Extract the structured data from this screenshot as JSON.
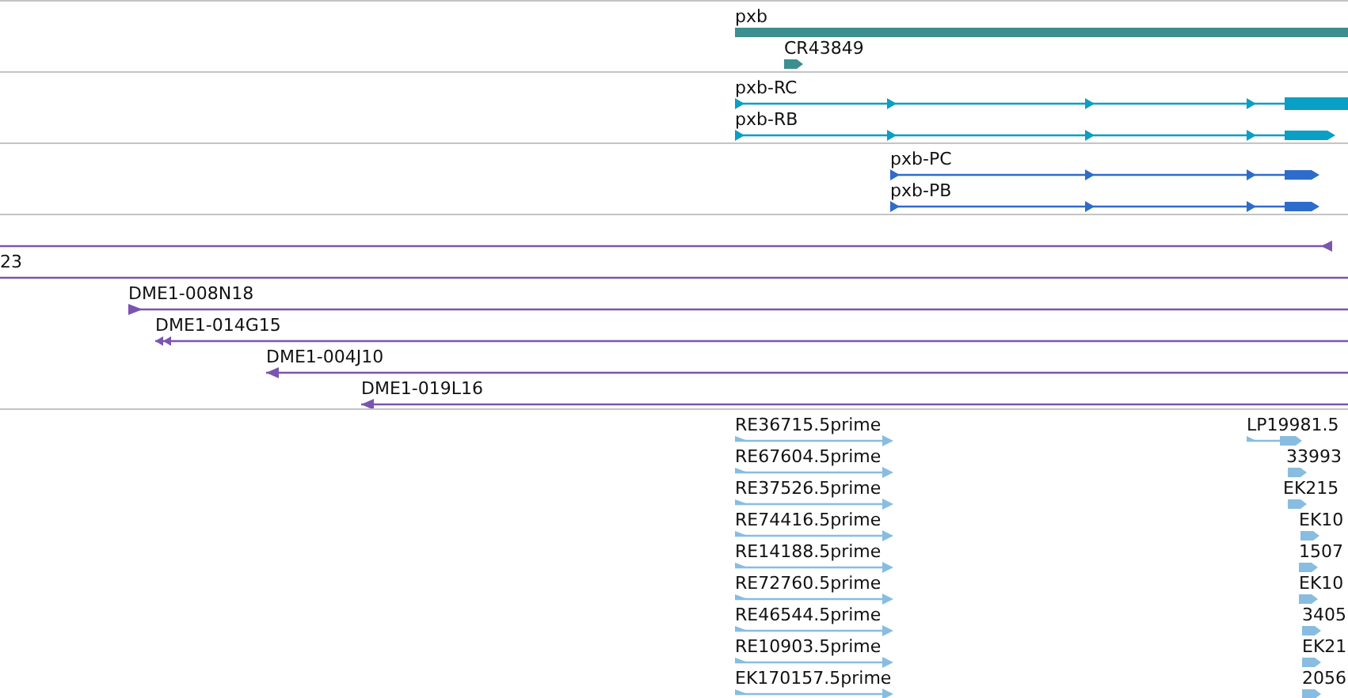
{
  "tracks": [
    {
      "kind": "gene",
      "color": "#3d8f8f",
      "features": [
        {
          "label": "pxb"
        },
        {
          "label": "CR43849"
        }
      ]
    },
    {
      "kind": "transcript",
      "color": "#0a9fc4",
      "features": [
        {
          "label": "pxb-RC"
        },
        {
          "label": "pxb-RB"
        }
      ]
    },
    {
      "kind": "transcript",
      "color": "#2e6ccc",
      "features": [
        {
          "label": "pxb-PC"
        },
        {
          "label": "pxb-PB"
        }
      ]
    },
    {
      "kind": "clone",
      "color": "#7b55b0",
      "features": [
        {
          "kind": "reverse"
        },
        {
          "label": "23"
        },
        {
          "label": "DME1-008N18",
          "kind": "forward"
        },
        {
          "label": "DME1-014G15",
          "kind": "reverse_pair"
        },
        {
          "label": "DME1-004J10",
          "kind": "reverse"
        },
        {
          "label": "DME1-019L16",
          "kind": "reverse"
        }
      ]
    },
    {
      "kind": "est",
      "color": "#88bde0",
      "features": [
        {
          "label": "RE36715.5prime"
        },
        {
          "label": "LP19981.5"
        },
        {
          "label": "RE67604.5prime"
        },
        {
          "label": "33993"
        },
        {
          "label": "RE37526.5prime"
        },
        {
          "label": "EK215"
        },
        {
          "label": "RE74416.5prime"
        },
        {
          "label": "EK10"
        },
        {
          "label": "RE14188.5prime"
        },
        {
          "label": "1507"
        },
        {
          "label": "RE72760.5prime"
        },
        {
          "label": "EK10"
        },
        {
          "label": "RE46544.5prime"
        },
        {
          "label": "3405"
        },
        {
          "label": "RE10903.5prime"
        },
        {
          "label": "EK21"
        },
        {
          "label": "EK170157.5prime"
        },
        {
          "label": "2056"
        }
      ]
    }
  ]
}
